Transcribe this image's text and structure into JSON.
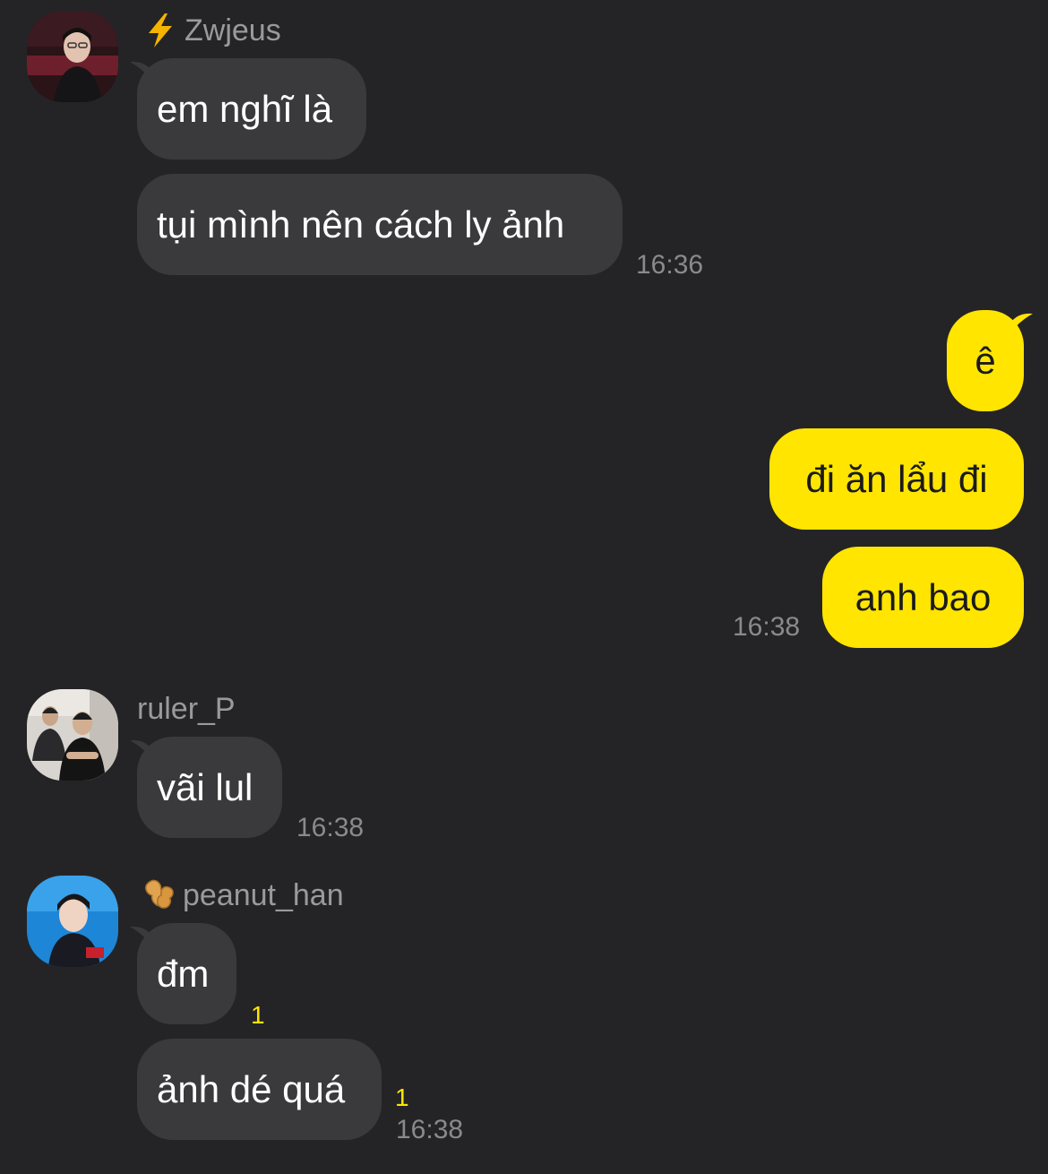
{
  "colors": {
    "background": "#242426",
    "incoming_bubble": "#3a3a3c",
    "outgoing_bubble": "#ffe500",
    "unread_count": "#ffe500",
    "meta_text": "#8a8a8e"
  },
  "groups": [
    {
      "sender": "Zwjeus",
      "sender_emoji": "lightning-icon",
      "messages": [
        "em nghĩ là",
        "tụi mình nên cách ly ảnh"
      ],
      "time": "16:36"
    },
    {
      "sender": "me",
      "messages": [
        "ê",
        "đi ăn lẩu đi",
        "anh bao"
      ],
      "time": "16:38"
    },
    {
      "sender": "ruler_P",
      "messages": [
        "vãi lul"
      ],
      "time": "16:38"
    },
    {
      "sender": "peanut_han",
      "sender_emoji": "peanut-icon",
      "messages": [
        "đm",
        "ảnh dé quá"
      ],
      "unread": [
        "1",
        "1"
      ],
      "time": "16:38"
    }
  ]
}
